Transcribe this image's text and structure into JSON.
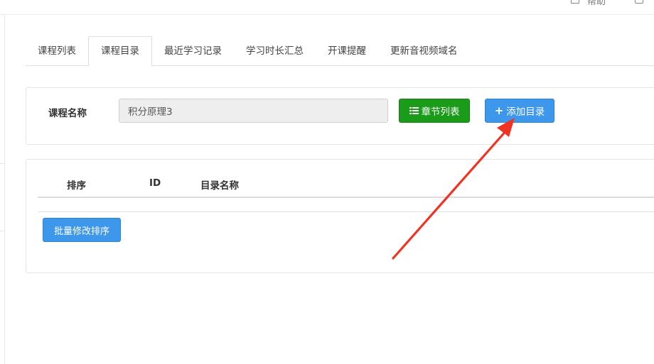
{
  "top_bar": {
    "text": "帮助"
  },
  "tabs": [
    {
      "label": "课程列表",
      "active": false
    },
    {
      "label": "课程目录",
      "active": true
    },
    {
      "label": "最近学习记录",
      "active": false
    },
    {
      "label": "学习时长汇总",
      "active": false
    },
    {
      "label": "开课提醒",
      "active": false
    },
    {
      "label": "更新音视频域名",
      "active": false
    }
  ],
  "form": {
    "course_label": "课程名称",
    "course_value": "积分原理3",
    "chapter_list_label": "章节列表",
    "add_catalog_label": "添加目录"
  },
  "table": {
    "columns": [
      "排序",
      "ID",
      "目录名称"
    ],
    "rows": [],
    "batch_button_label": "批量修改排序"
  },
  "icons": {
    "chapter_list": "list-icon",
    "add_catalog": "plus-icon",
    "annotation": "red-arrow"
  },
  "colors": {
    "green_button": "#1a9b1a",
    "blue_button": "#3d97ea",
    "annotation_arrow": "#f03323"
  }
}
